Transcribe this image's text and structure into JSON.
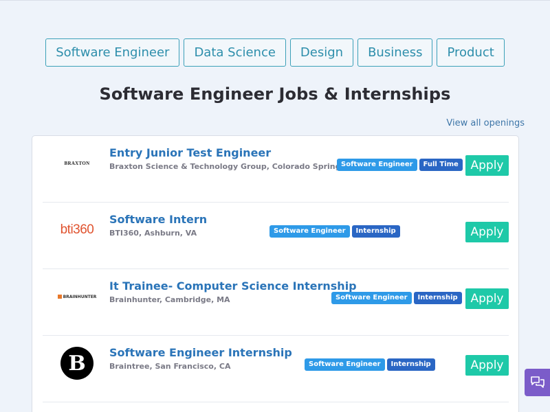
{
  "tabs": [
    "Software Engineer",
    "Data Science",
    "Design",
    "Business",
    "Product"
  ],
  "heading": "Software Engineer Jobs & Internships",
  "view_all": "View all openings",
  "apply_label": "Apply",
  "jobs": [
    {
      "title": "Entry Junior Test Engineer",
      "company": "Braxton Science & Technology Group, Colorado Springs, CO",
      "logo_text": "BRAXTON",
      "tags": [
        "Software Engineer",
        "Full Time"
      ]
    },
    {
      "title": "Software Intern",
      "company": "BTI360, Ashburn, VA",
      "logo_text": "bti360",
      "tags": [
        "Software Engineer",
        "Internship"
      ]
    },
    {
      "title": "It Trainee- Computer Science Internship",
      "company": "Brainhunter, Cambridge, MA",
      "logo_text": "BRAINHUNTER",
      "tags": [
        "Software Engineer",
        "Internship"
      ]
    },
    {
      "title": "Software Engineer Internship",
      "company": "Braintree, San Francisco, CA",
      "logo_text": "B",
      "tags": [
        "Software Engineer",
        "Internship"
      ]
    }
  ],
  "colors": {
    "accent": "#2d8eab",
    "apply": "#1ec9a8",
    "tag_category": "#2e9ae8",
    "tag_type": "#2a66c4",
    "title": "#2a74b8",
    "chat": "#7b5cc9"
  },
  "icons": {
    "chat": "chat-bubbles-icon"
  }
}
